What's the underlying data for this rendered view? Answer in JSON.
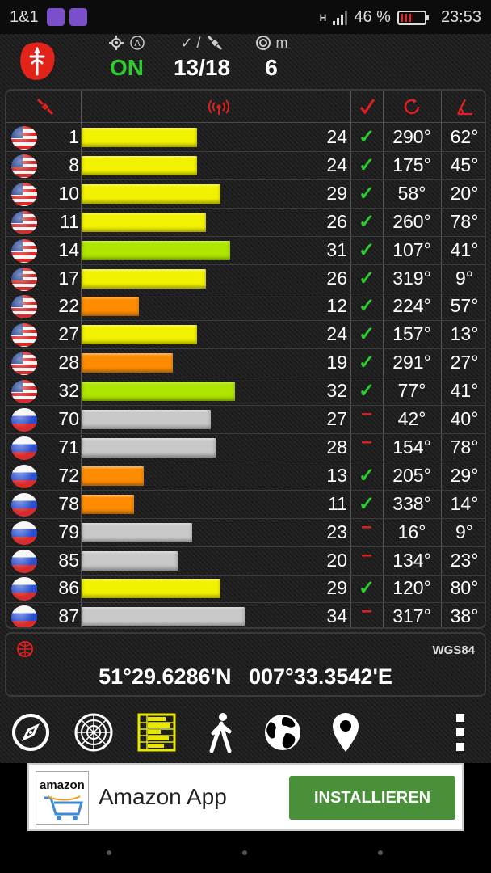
{
  "status_bar": {
    "carrier": "1&1",
    "network": "H",
    "battery": "46 %",
    "time": "23:53"
  },
  "header": {
    "fix_caption": "A",
    "fix_status": "ON",
    "fix_color": "#2ecc2e",
    "satellites_caption": "✓ /",
    "satellites_value": "13/18",
    "accuracy_caption": "m",
    "accuracy_value": "6"
  },
  "table": {
    "columns": [
      "satellite-icon",
      "signal-icon",
      "check-icon",
      "azimuth-icon",
      "elevation-icon"
    ],
    "rows": [
      {
        "flag": "us",
        "prn": "1",
        "snr": "24",
        "snr_value": 24,
        "color": "#f2f200",
        "used": "✓",
        "azimuth": "290°",
        "elevation": "62°"
      },
      {
        "flag": "us",
        "prn": "8",
        "snr": "24",
        "snr_value": 24,
        "color": "#f2f200",
        "used": "✓",
        "azimuth": "175°",
        "elevation": "45°"
      },
      {
        "flag": "us",
        "prn": "10",
        "snr": "29",
        "snr_value": 29,
        "color": "#f2f200",
        "used": "✓",
        "azimuth": "58°",
        "elevation": "20°"
      },
      {
        "flag": "us",
        "prn": "11",
        "snr": "26",
        "snr_value": 26,
        "color": "#f2f200",
        "used": "✓",
        "azimuth": "260°",
        "elevation": "78°"
      },
      {
        "flag": "us",
        "prn": "14",
        "snr": "31",
        "snr_value": 31,
        "color": "#aee600",
        "used": "✓",
        "azimuth": "107°",
        "elevation": "41°"
      },
      {
        "flag": "us",
        "prn": "17",
        "snr": "26",
        "snr_value": 26,
        "color": "#f2f200",
        "used": "✓",
        "azimuth": "319°",
        "elevation": "9°"
      },
      {
        "flag": "us",
        "prn": "22",
        "snr": "12",
        "snr_value": 12,
        "color": "#ff8c00",
        "used": "✓",
        "azimuth": "224°",
        "elevation": "57°"
      },
      {
        "flag": "us",
        "prn": "27",
        "snr": "24",
        "snr_value": 24,
        "color": "#f2f200",
        "used": "✓",
        "azimuth": "157°",
        "elevation": "13°"
      },
      {
        "flag": "us",
        "prn": "28",
        "snr": "19",
        "snr_value": 19,
        "color": "#ff8c00",
        "used": "✓",
        "azimuth": "291°",
        "elevation": "27°"
      },
      {
        "flag": "us",
        "prn": "32",
        "snr": "32",
        "snr_value": 32,
        "color": "#aee600",
        "used": "✓",
        "azimuth": "77°",
        "elevation": "41°"
      },
      {
        "flag": "ru",
        "prn": "70",
        "snr": "27",
        "snr_value": 27,
        "color": "#c8c8c8",
        "used": "–",
        "azimuth": "42°",
        "elevation": "40°"
      },
      {
        "flag": "ru",
        "prn": "71",
        "snr": "28",
        "snr_value": 28,
        "color": "#c8c8c8",
        "used": "–",
        "azimuth": "154°",
        "elevation": "78°"
      },
      {
        "flag": "ru",
        "prn": "72",
        "snr": "13",
        "snr_value": 13,
        "color": "#ff8c00",
        "used": "✓",
        "azimuth": "205°",
        "elevation": "29°"
      },
      {
        "flag": "ru",
        "prn": "78",
        "snr": "11",
        "snr_value": 11,
        "color": "#ff8c00",
        "used": "✓",
        "azimuth": "338°",
        "elevation": "14°"
      },
      {
        "flag": "ru",
        "prn": "79",
        "snr": "23",
        "snr_value": 23,
        "color": "#c8c8c8",
        "used": "–",
        "azimuth": "16°",
        "elevation": "9°"
      },
      {
        "flag": "ru",
        "prn": "85",
        "snr": "20",
        "snr_value": 20,
        "color": "#c8c8c8",
        "used": "–",
        "azimuth": "134°",
        "elevation": "23°"
      },
      {
        "flag": "ru",
        "prn": "86",
        "snr": "29",
        "snr_value": 29,
        "color": "#f2f200",
        "used": "✓",
        "azimuth": "120°",
        "elevation": "80°"
      },
      {
        "flag": "ru",
        "prn": "87",
        "snr": "34",
        "snr_value": 34,
        "color": "#c8c8c8",
        "used": "–",
        "azimuth": "317°",
        "elevation": "38°"
      }
    ]
  },
  "position": {
    "datum": "WGS84",
    "latitude": "51°29.6286'N",
    "longitude": "007°33.3542'E"
  },
  "toolbar": {
    "items": [
      "compass-icon",
      "radar-icon",
      "signal-bars-icon",
      "walking-icon",
      "globe-icon",
      "map-pin-icon",
      "more-vert-icon"
    ],
    "active": "signal-bars-icon",
    "active_color": "#e8e800"
  },
  "ad": {
    "logo_text": "amazon",
    "title": "Amazon App",
    "button_label": "INSTALLIEREN",
    "button_color": "#4a8f3a"
  }
}
